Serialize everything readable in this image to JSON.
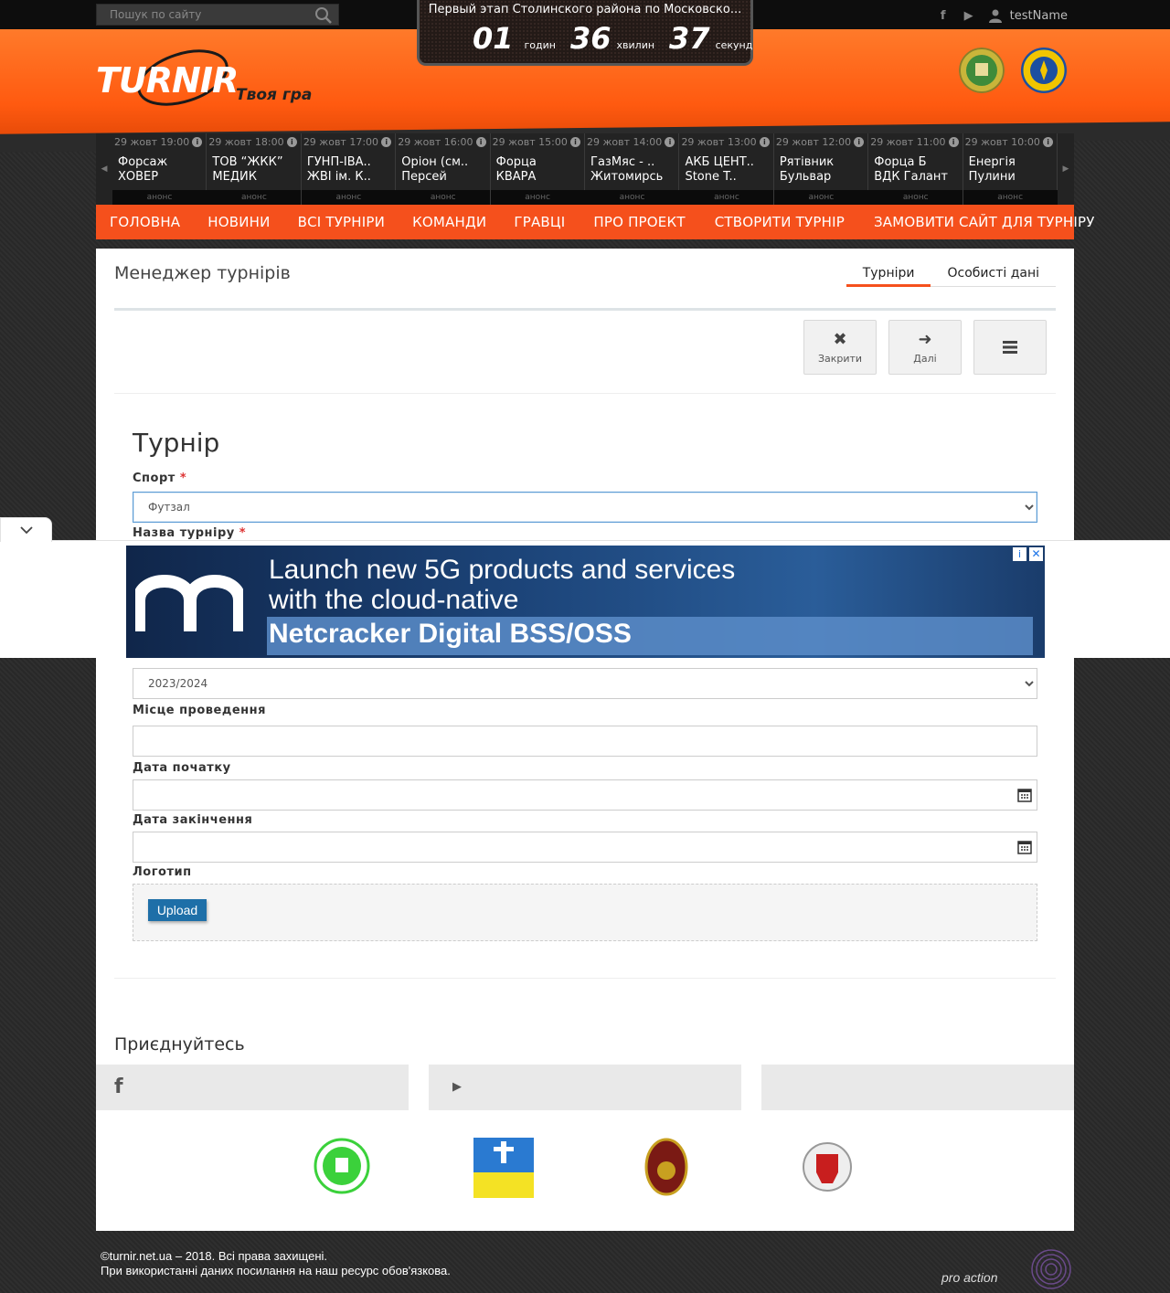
{
  "search": {
    "placeholder": "Пошук по сайту"
  },
  "user": {
    "name": "testName"
  },
  "countdown": {
    "title": "Первый этап Столинского района по Московско...",
    "hours": "01",
    "hours_label": "годин",
    "minutes": "36",
    "minutes_label": "хвилин",
    "seconds": "37",
    "seconds_label": "секунд"
  },
  "logo": {
    "word": "TURNIR",
    "slogan": "Твоя гра"
  },
  "matches": [
    {
      "date": "29 жовт 19:00",
      "team1": "Форсаж",
      "team2": "ХОВЕР",
      "status": "анонс"
    },
    {
      "date": "29 жовт 18:00",
      "team1": "ТОВ “ЖКК”",
      "team2": "МЕДИК",
      "status": "анонс"
    },
    {
      "date": "29 жовт 17:00",
      "team1": "ГУНП-ІВА..",
      "team2": "ЖВІ ім. К..",
      "status": "анонс"
    },
    {
      "date": "29 жовт 16:00",
      "team1": "Оріон (см..",
      "team2": "Персей",
      "status": "анонс"
    },
    {
      "date": "29 жовт 15:00",
      "team1": "Форца",
      "team2": "КВАРА",
      "status": "анонс"
    },
    {
      "date": "29 жовт 14:00",
      "team1": "ГазМяс - ..",
      "team2": "Житомирсь",
      "status": "анонс"
    },
    {
      "date": "29 жовт 13:00",
      "team1": "АКБ ЦЕНТ..",
      "team2": "Stone T..",
      "status": "анонс"
    },
    {
      "date": "29 жовт 12:00",
      "team1": "Рятівник",
      "team2": "Бульвар",
      "status": "анонс"
    },
    {
      "date": "29 жовт 11:00",
      "team1": "Форца Б",
      "team2": "ВДК Галант",
      "status": "анонс"
    },
    {
      "date": "29 жовт 10:00",
      "team1": "Енергія",
      "team2": "Пулини",
      "status": "анонс"
    }
  ],
  "nav": [
    "ГОЛОВНА",
    "НОВИНИ",
    "ВСІ ТУРНІРИ",
    "КОМАНДИ",
    "ГРАВЦІ",
    "ПРО ПРОЕКТ",
    "СТВОРИТИ ТУРНІР",
    "ЗАМОВИТИ САЙТ ДЛЯ ТУРНІРУ"
  ],
  "page": {
    "title": "Менеджер турнірів",
    "tabs": [
      "Турніри",
      "Особисті дані"
    ],
    "actions": {
      "close": "Закрити",
      "next": "Далі"
    }
  },
  "form": {
    "title": "Турнір",
    "sport_label": "Спорт",
    "sport_value": "Футзал",
    "name_label": "Назва турніру",
    "season_value": "2023/2024",
    "venue_label": "Місце проведення",
    "start_label": "Дата початку",
    "end_label": "Дата закінчення",
    "logo_label": "Логотип",
    "upload_label": "Upload",
    "required_mark": "*"
  },
  "join": {
    "title": "Приєднуйтесь"
  },
  "ad": {
    "line1": "Launch new 5G products and services",
    "line2": "with the cloud-native",
    "line3": "Netcracker Digital BSS/OSS"
  },
  "footer": {
    "line1": "©turnir.net.ua – 2018. Всі права захищені.",
    "line2": "При використанні даних посилання на наш ресурс обов'язкова.",
    "credit": "pro action"
  },
  "colors": {
    "accent": "#f5501c",
    "header": "#ff6a1f",
    "upload": "#1e6fa8"
  }
}
